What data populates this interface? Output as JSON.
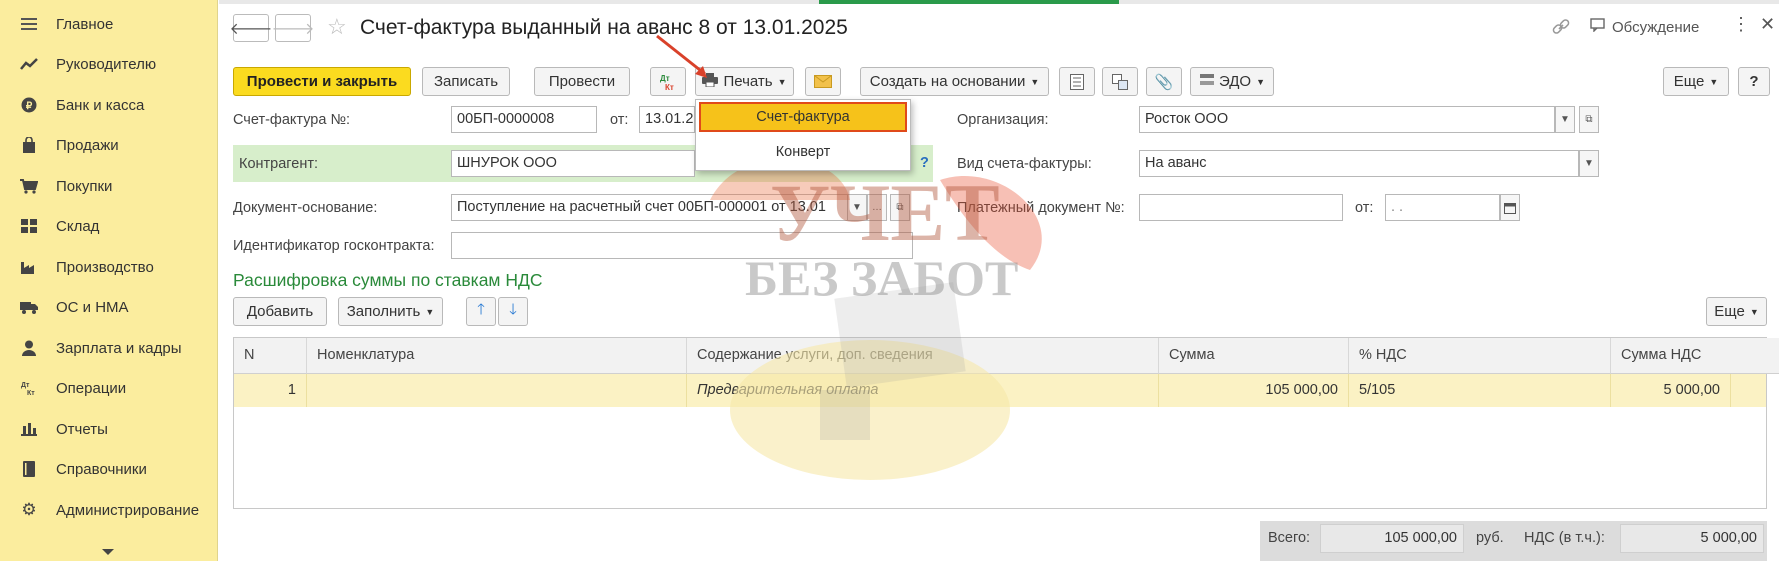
{
  "sidebar": {
    "items": [
      {
        "label": "Главное",
        "icon": "menu-icon"
      },
      {
        "label": "Руководителю",
        "icon": "trend-icon"
      },
      {
        "label": "Банк и касса",
        "icon": "coin-icon"
      },
      {
        "label": "Продажи",
        "icon": "bag-icon"
      },
      {
        "label": "Покупки",
        "icon": "cart-icon"
      },
      {
        "label": "Склад",
        "icon": "warehouse-icon"
      },
      {
        "label": "Производство",
        "icon": "factory-icon"
      },
      {
        "label": "ОС и НМА",
        "icon": "truck-icon"
      },
      {
        "label": "Зарплата и кадры",
        "icon": "person-icon"
      },
      {
        "label": "Операции",
        "icon": "dt-kt-icon"
      },
      {
        "label": "Отчеты",
        "icon": "bar-chart-icon"
      },
      {
        "label": "Справочники",
        "icon": "book-icon"
      },
      {
        "label": "Администрирование",
        "icon": "gear-icon"
      }
    ]
  },
  "header": {
    "title": "Счет-фактура выданный на аванс 8 от 13.01.2025",
    "discussion": "Обсуждение"
  },
  "toolbar": {
    "post_close": "Провести и закрыть",
    "save": "Записать",
    "post": "Провести",
    "dtkt": "Дт Кт",
    "print": "Печать",
    "create_based": "Создать на основании",
    "edo": "ЭДО",
    "more": "Еще",
    "help": "?"
  },
  "print_menu": {
    "items": [
      "Счет-фактура",
      "Конверт"
    ]
  },
  "form": {
    "invoice_no_label": "Счет-фактура №:",
    "invoice_no": "00БП-0000008",
    "from_label": "от:",
    "from_date": "13.01.2",
    "org_label": "Организация:",
    "org": "Росток ООО",
    "contractor_label": "Контрагент:",
    "contractor": "ШНУРОК ООО",
    "kind_label": "Вид счета-фактуры:",
    "kind": "На аванс",
    "basis_label": "Документ-основание:",
    "basis": "Поступление на расчетный счет 00БП-000001 от 13.01",
    "paydoc_label": "Платежный документ №:",
    "paydoc_no": "",
    "paydoc_from_label": "от:",
    "paydoc_date": " .  .",
    "gov_label": "Идентификатор госконтракта:",
    "gov": ""
  },
  "section": {
    "title": "Расшифровка суммы по ставкам НДС",
    "add": "Добавить",
    "fill": "Заполнить",
    "more": "Еще"
  },
  "table": {
    "columns": [
      "N",
      "Номенклатура",
      "Содержание услуги, доп. сведения",
      "Сумма",
      "% НДС",
      "Сумма НДС"
    ],
    "rows": [
      {
        "n": "1",
        "nomenclature": "",
        "content": "Предварительная оплата",
        "sum": "105 000,00",
        "vat_rate": "5/105",
        "vat_sum": "5 000,00"
      }
    ]
  },
  "footer": {
    "total_label": "Всего:",
    "total": "105 000,00",
    "currency": "руб.",
    "vat_label": "НДС (в т.ч.):",
    "vat": "5 000,00"
  },
  "watermark": {
    "line1": "УЧЕТ",
    "line2": "БЕЗ ЗАБОТ"
  },
  "colors": {
    "sidebar_bg": "#fbed9e",
    "primary_button": "#fbdb1f",
    "section_title": "#2a8a3a",
    "selected_row": "#fbf2c4",
    "menu_highlight": "#f6c21a",
    "arrow": "#d9412a"
  }
}
